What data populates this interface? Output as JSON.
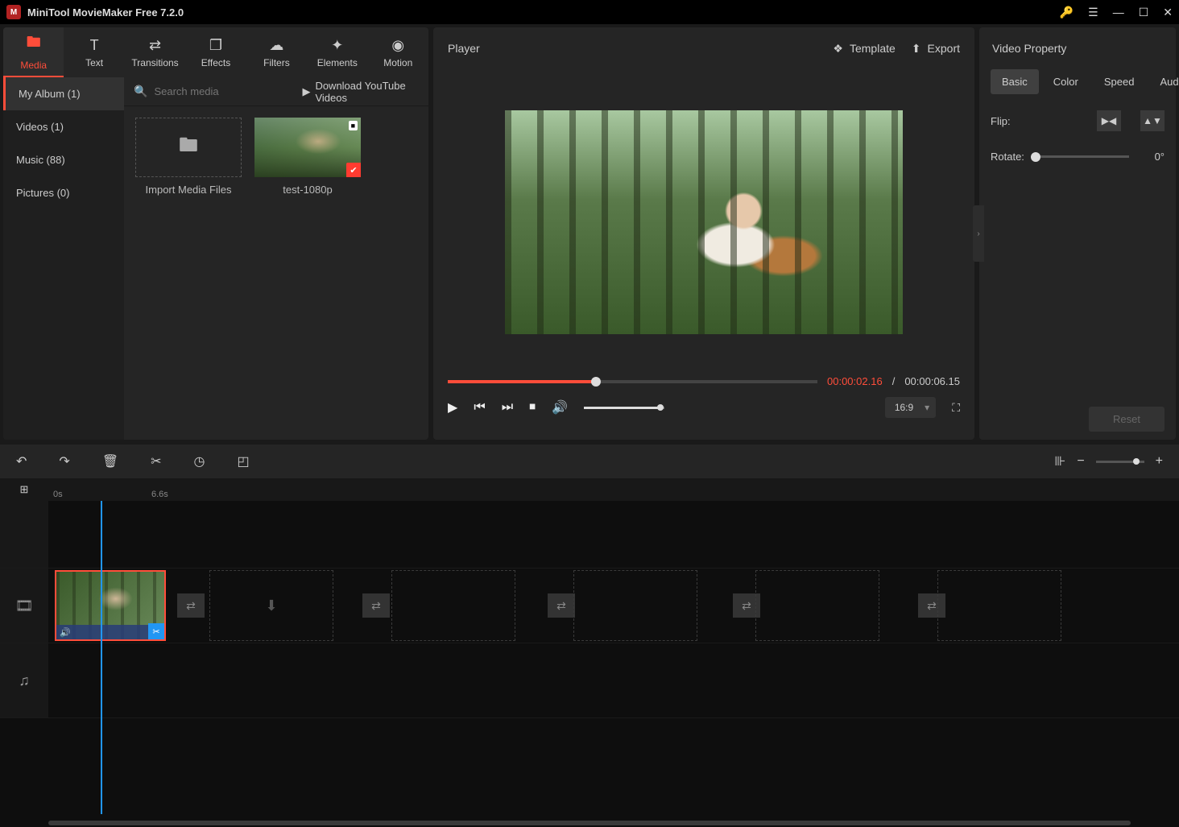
{
  "titlebar": {
    "title": "MiniTool MovieMaker Free 7.2.0"
  },
  "toptabs": {
    "media": "Media",
    "text": "Text",
    "transitions": "Transitions",
    "effects": "Effects",
    "filters": "Filters",
    "elements": "Elements",
    "motion": "Motion"
  },
  "mediaSidebar": {
    "album": "My Album (1)",
    "videos": "Videos (1)",
    "music": "Music (88)",
    "pictures": "Pictures (0)"
  },
  "mediaToolbar": {
    "searchPlaceholder": "Search media",
    "ytLink": "Download YouTube Videos"
  },
  "mediaItems": {
    "import": "Import Media Files",
    "clip1": "test-1080p"
  },
  "player": {
    "title": "Player",
    "template": "Template",
    "export": "Export",
    "curTime": "00:00:02.16",
    "sep": "/",
    "totTime": "00:00:06.15",
    "aspect": "16:9"
  },
  "props": {
    "title": "Video Property",
    "tabs": {
      "basic": "Basic",
      "color": "Color",
      "speed": "Speed",
      "audio": "Audio"
    },
    "flipLabel": "Flip:",
    "rotateLabel": "Rotate:",
    "rotateVal": "0°",
    "reset": "Reset"
  },
  "timeline": {
    "ruler": {
      "t0": "0s",
      "t1": "6.6s"
    }
  }
}
